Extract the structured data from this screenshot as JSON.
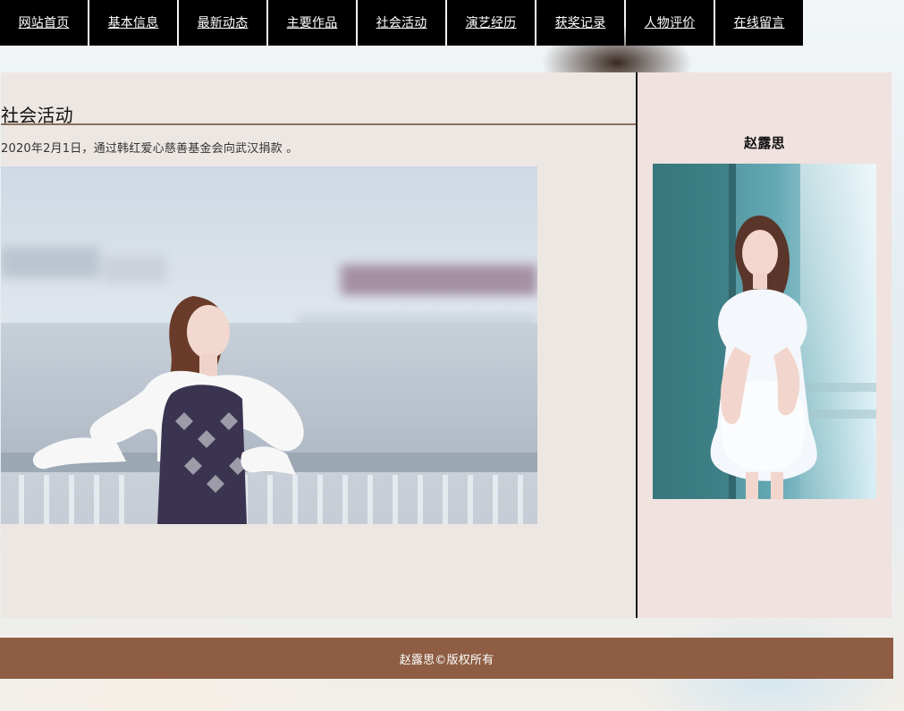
{
  "nav": {
    "items": [
      {
        "label": "网站首页"
      },
      {
        "label": "基本信息"
      },
      {
        "label": "最新动态"
      },
      {
        "label": "主要作品"
      },
      {
        "label": "社会活动"
      },
      {
        "label": "演艺经历"
      },
      {
        "label": "获奖记录"
      },
      {
        "label": "人物评价"
      },
      {
        "label": "在线留言"
      }
    ]
  },
  "main": {
    "section_title": "社会活动",
    "post_text": "2020年2月1日，通过韩红爱心慈善基金会向武汉捐款 。",
    "main_photo_name": "photo-outdoor-railing"
  },
  "sidebar": {
    "name": "赵露思",
    "photo_name": "photo-portrait-window"
  },
  "footer": {
    "text": "赵露思©版权所有"
  },
  "colors": {
    "nav_bg": "#000000",
    "main_bg": "#ede7e3",
    "sidebar_bg": "#efe2df",
    "footer_bg": "#8e5d43",
    "rule": "#8a6f5e"
  }
}
